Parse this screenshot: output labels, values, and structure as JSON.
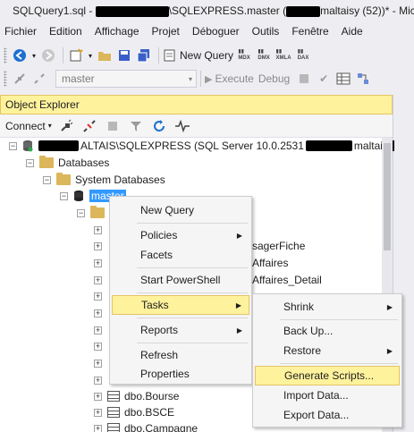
{
  "window": {
    "title_prefix": "SQLQuery1.sql - ",
    "title_middle": "\\SQLEXPRESS.master (",
    "title_suffix": "maltaisy (52))* - Mic"
  },
  "menu": [
    "Fichier",
    "Edition",
    "Affichage",
    "Projet",
    "Déboguer",
    "Outils",
    "Fenêtre",
    "Aide"
  ],
  "toolbar": {
    "new_query": "New Query",
    "database": "master",
    "execute": "Execute",
    "debug": "Debug"
  },
  "object_explorer": {
    "title": "Object Explorer",
    "connect": "Connect"
  },
  "tree": {
    "server": "ALTAIS\\SQLEXPRESS (SQL Server 10.0.2531",
    "server_tail": "maltai",
    "databases": "Databases",
    "system_databases": "System Databases",
    "master": "master",
    "partial_rows": [
      "sagerFiche",
      "Affaires",
      "Affaires_Detail"
    ],
    "tables": [
      "dbo.Bourse",
      "dbo.BSCE",
      "dbo.Campagne"
    ]
  },
  "context_menu": {
    "items": [
      "New Query",
      "Policies",
      "Facets",
      "Start PowerShell",
      "Tasks",
      "Reports",
      "Refresh",
      "Properties"
    ]
  },
  "tasks_menu": {
    "items": [
      "Shrink",
      "Back Up...",
      "Restore",
      "Generate Scripts...",
      "Import Data...",
      "Export Data..."
    ]
  },
  "colors": {
    "highlight": "#fff29d",
    "selection": "#3399ff"
  }
}
